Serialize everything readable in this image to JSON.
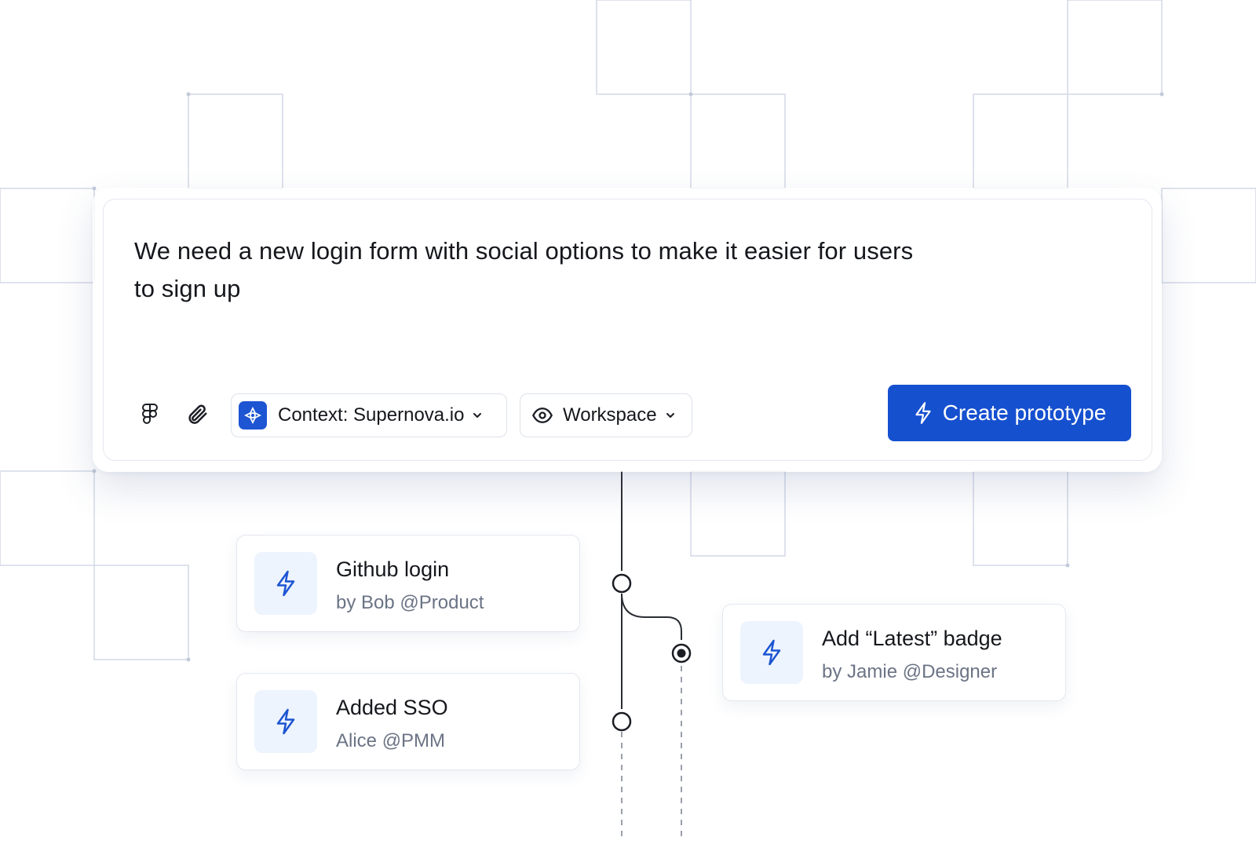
{
  "composer": {
    "prompt_text": "We need a new login form with social options to make it easier for users to sign up",
    "toolbar": {
      "figma_icon": "figma-icon",
      "attach_icon": "paperclip-icon",
      "context_label": "Context: Supernova.io",
      "visibility_label": "Workspace",
      "create_label": "Create prototype"
    }
  },
  "timeline": {
    "cards": [
      {
        "title": "Github login",
        "subtitle": "by Bob @Product",
        "icon": "lightning-icon"
      },
      {
        "title": "Added SSO",
        "subtitle": "Alice @PMM",
        "icon": "lightning-icon"
      },
      {
        "title": "Add “Latest” badge",
        "subtitle": "by Jamie @Designer",
        "icon": "lightning-icon"
      }
    ]
  },
  "colors": {
    "accent": "#1550cf",
    "icon_tile": "#edf4fd",
    "grid_line": "#d3d9e6"
  }
}
